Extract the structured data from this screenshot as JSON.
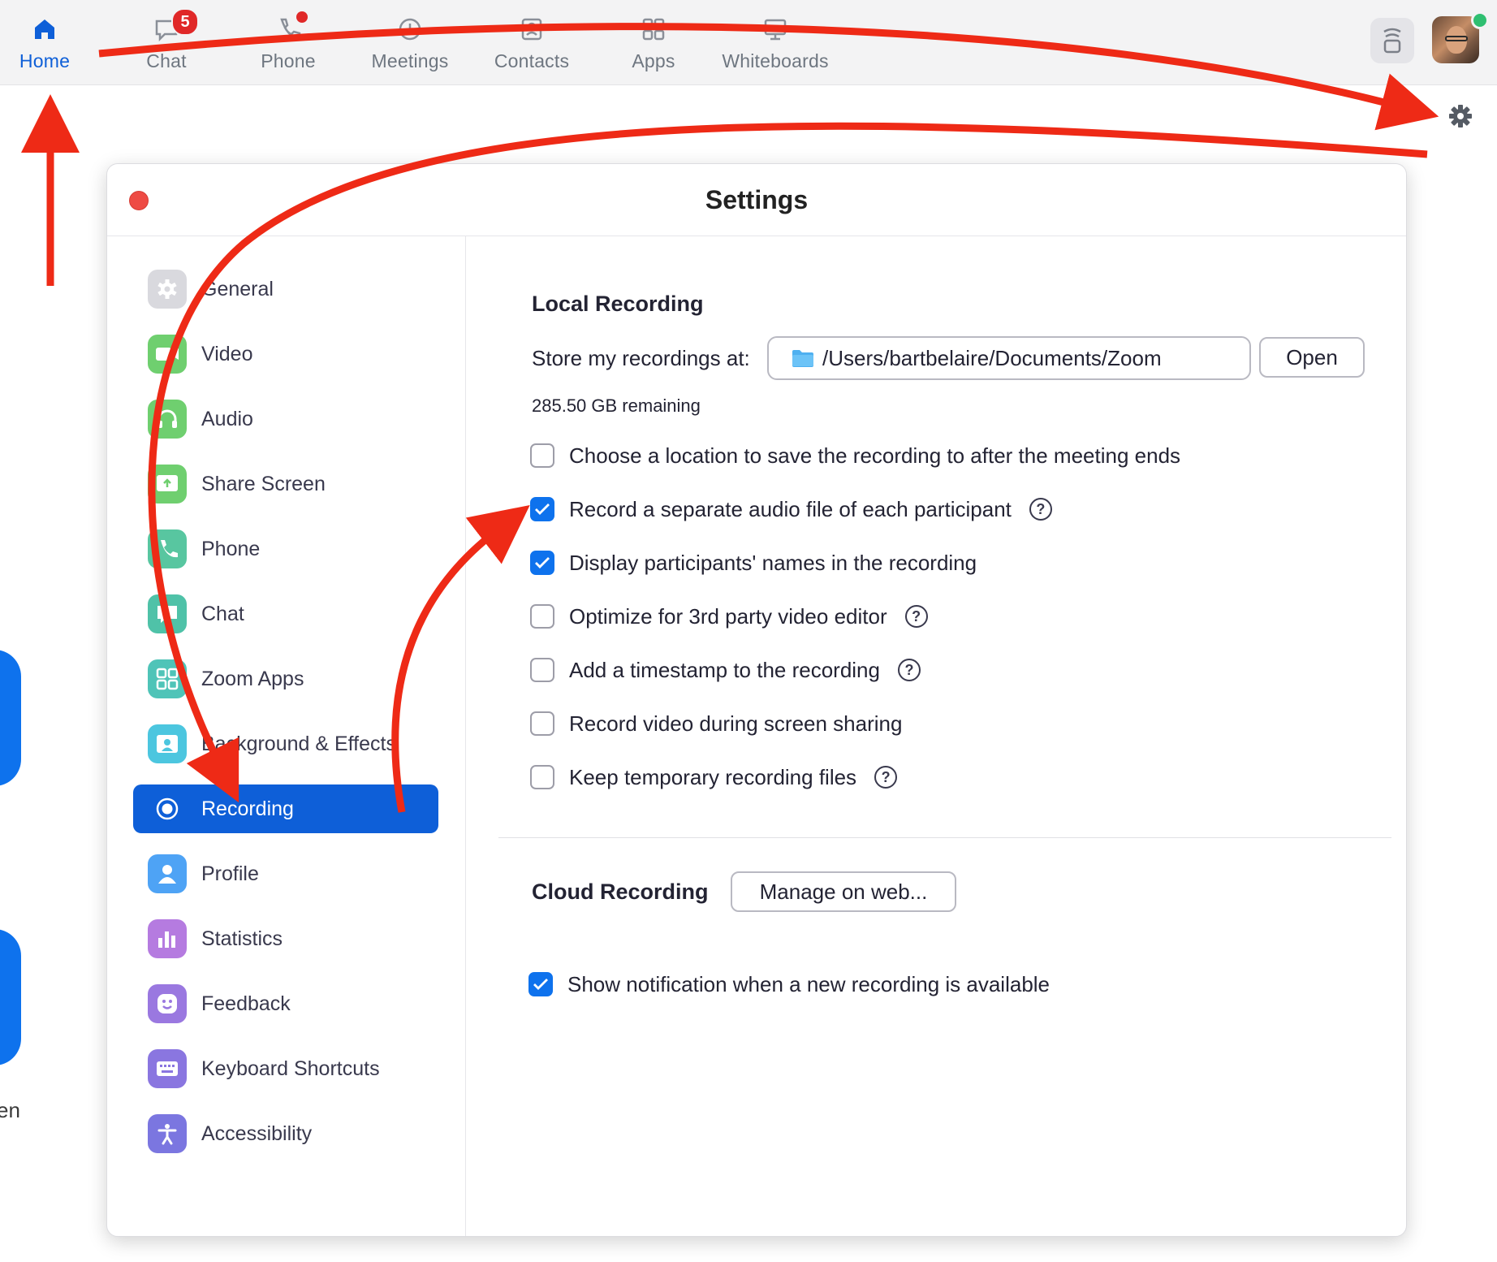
{
  "topnav": {
    "items": [
      {
        "label": "Home",
        "icon": "home-icon"
      },
      {
        "label": "Chat",
        "icon": "chat-icon",
        "badge": "5"
      },
      {
        "label": "Phone",
        "icon": "phone-icon"
      },
      {
        "label": "Meetings",
        "icon": "clock-icon"
      },
      {
        "label": "Contacts",
        "icon": "contacts-icon"
      },
      {
        "label": "Apps",
        "icon": "apps-icon"
      },
      {
        "label": "Whiteboards",
        "icon": "whiteboard-icon"
      }
    ],
    "active": "Home",
    "accent_color": "#0e5fd8"
  },
  "settings": {
    "title": "Settings",
    "sidebar": [
      {
        "label": "General",
        "icon": "gear-icon",
        "color": "#d9d9de"
      },
      {
        "label": "Video",
        "icon": "video-camera-icon",
        "color": "#6fcf6f"
      },
      {
        "label": "Audio",
        "icon": "headphones-icon",
        "color": "#6fcf6f"
      },
      {
        "label": "Share Screen",
        "icon": "share-screen-icon",
        "color": "#6fcf6f"
      },
      {
        "label": "Phone",
        "icon": "phone-icon",
        "color": "#58c6a0"
      },
      {
        "label": "Chat",
        "icon": "chat-icon",
        "color": "#4fc2a8"
      },
      {
        "label": "Zoom Apps",
        "icon": "apps-icon",
        "color": "#4fc4b8"
      },
      {
        "label": "Background & Effects",
        "icon": "background-icon",
        "color": "#4cc6df"
      },
      {
        "label": "Recording",
        "icon": "record-icon",
        "color": "#0e5fd8"
      },
      {
        "label": "Profile",
        "icon": "profile-icon",
        "color": "#4ea3f5"
      },
      {
        "label": "Statistics",
        "icon": "statistics-icon",
        "color": "#b57be0"
      },
      {
        "label": "Feedback",
        "icon": "feedback-icon",
        "color": "#9a78e0"
      },
      {
        "label": "Keyboard Shortcuts",
        "icon": "keyboard-icon",
        "color": "#8a76e0"
      },
      {
        "label": "Accessibility",
        "icon": "accessibility-icon",
        "color": "#7b76e0"
      }
    ],
    "selected": "Recording",
    "local": {
      "title": "Local Recording",
      "store_label": "Store my recordings at:",
      "path": "/Users/bartbelaire/Documents/Zoom",
      "open_button": "Open",
      "remaining": "285.50 GB remaining",
      "options": [
        {
          "label": "Choose a location to save the recording to after the meeting ends",
          "checked": false,
          "help": false
        },
        {
          "label": "Record a separate audio file of each participant",
          "checked": true,
          "help": true
        },
        {
          "label": "Display participants' names in the recording",
          "checked": true,
          "help": false
        },
        {
          "label": "Optimize for 3rd party video editor",
          "checked": false,
          "help": true
        },
        {
          "label": "Add a timestamp to the recording",
          "checked": false,
          "help": true
        },
        {
          "label": "Record video during screen sharing",
          "checked": false,
          "help": false
        },
        {
          "label": "Keep temporary recording files",
          "checked": false,
          "help": true
        }
      ]
    },
    "cloud": {
      "title": "Cloud Recording",
      "manage_button": "Manage on web...",
      "notify": {
        "label": "Show notification when a new recording is available",
        "checked": true
      }
    }
  },
  "background": {
    "partial_text": "en"
  },
  "colors": {
    "annotation_arrow": "#ee2a16",
    "checkbox_on": "#0e72ed"
  }
}
